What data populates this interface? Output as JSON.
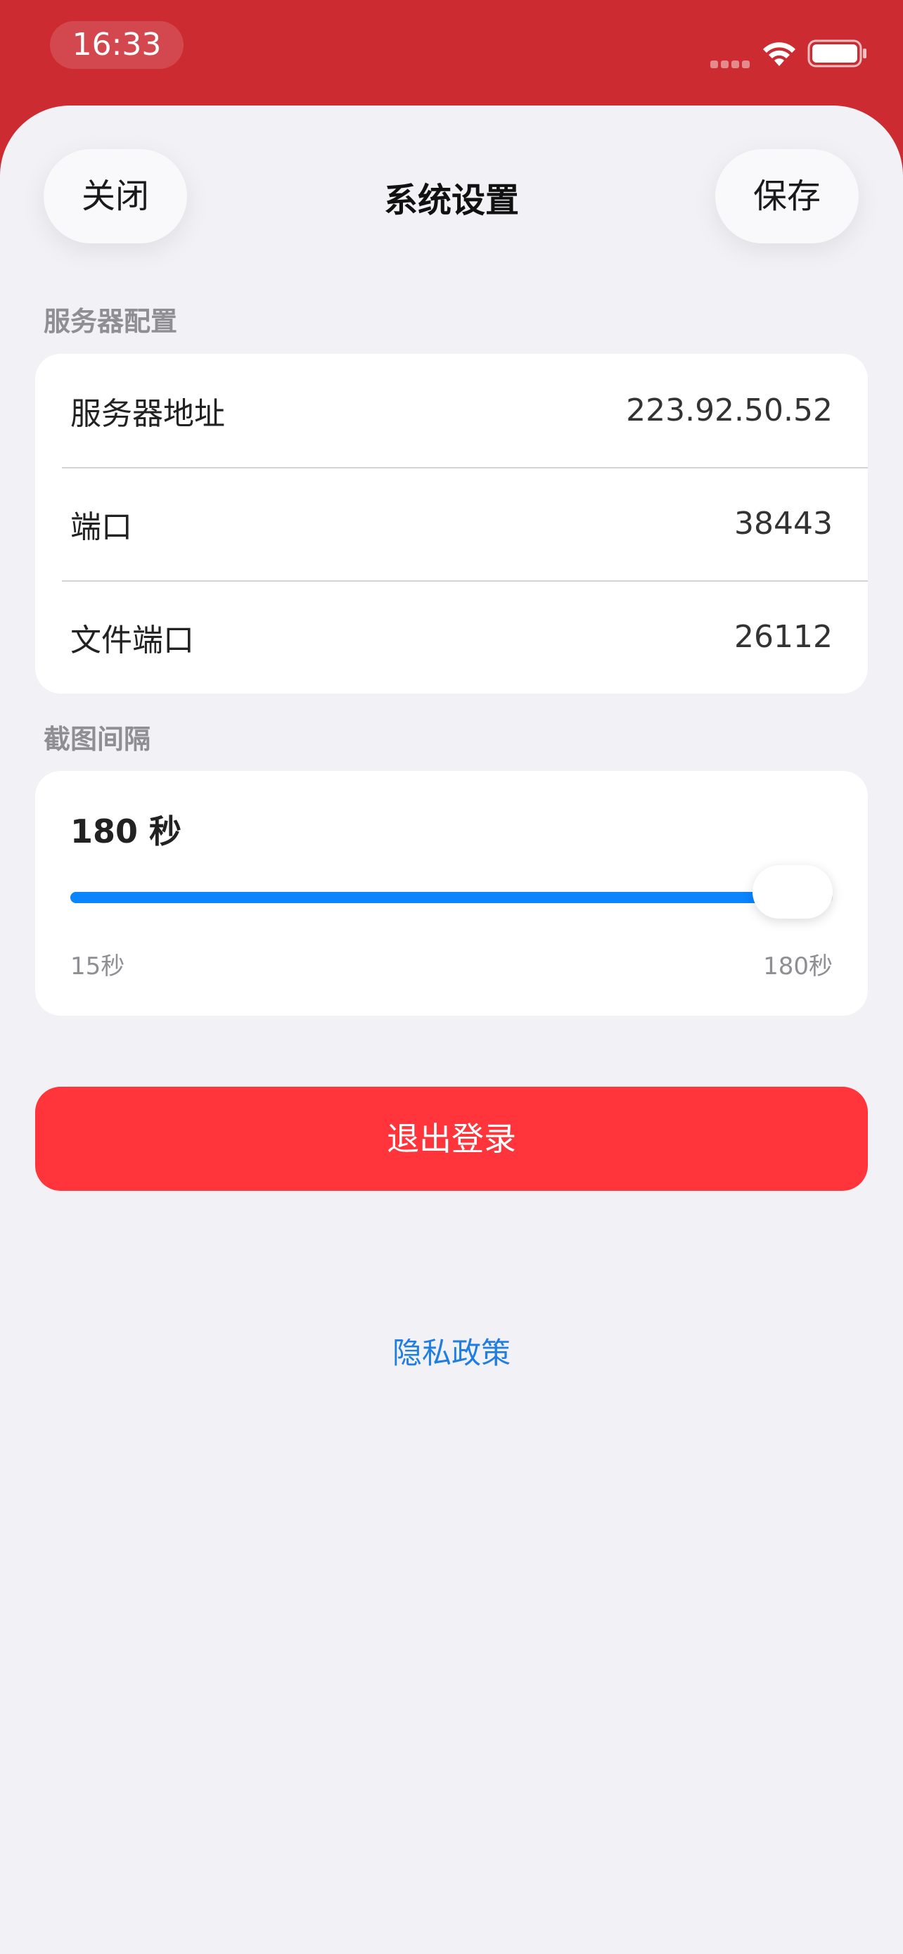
{
  "status_bar": {
    "time": "16:33"
  },
  "nav": {
    "close_label": "关闭",
    "title": "系统设置",
    "save_label": "保存"
  },
  "server_config": {
    "header": "服务器配置",
    "rows": [
      {
        "label": "服务器地址",
        "value": "223.92.50.52"
      },
      {
        "label": "端口",
        "value": "38443"
      },
      {
        "label": "文件端口",
        "value": "26112"
      }
    ]
  },
  "screenshot_interval": {
    "header": "截图间隔",
    "value_text": "180 秒",
    "min_label": "15秒",
    "max_label": "180秒",
    "slider": {
      "min": 15,
      "max": 180,
      "value": 180
    }
  },
  "logout_label": "退出登录",
  "privacy_label": "隐私政策",
  "colors": {
    "status_bar_bg": "#cc2b31",
    "sheet_bg": "#f1f1f6",
    "slider_accent": "#0a84ff",
    "logout_bg": "#ff353b",
    "link": "#1f7ee0"
  },
  "icons": [
    "signal-icon",
    "wifi-icon",
    "battery-icon"
  ]
}
